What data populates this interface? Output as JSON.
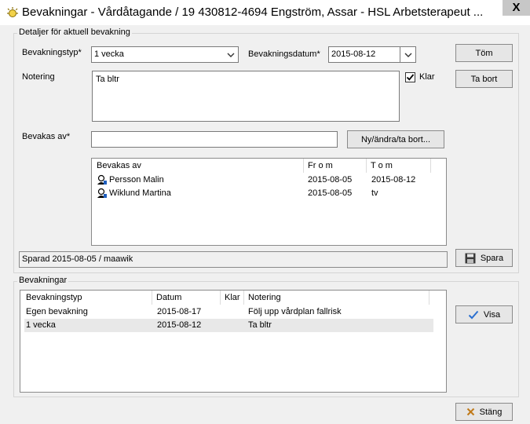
{
  "window": {
    "title": "Bevakningar - Vårdåtagande /  19 430812-4694   Engström, Assar   -   HSL Arbetsterapeut  ...",
    "close_label": "X"
  },
  "details": {
    "legend": "Detaljer för aktuell bevakning",
    "type_label": "Bevakningstyp*",
    "type_value": "1 vecka",
    "date_label": "Bevakningsdatum*",
    "date_value": "2015-08-12",
    "note_label": "Notering",
    "note_value": "Ta bltr",
    "done_label": "Klar",
    "done_checked": true,
    "watched_by_label": "Bevakas av*",
    "watched_by_value": "",
    "new_edit_remove_label": "Ny/ändra/ta bort...",
    "clear_label": "Töm",
    "remove_label": "Ta bort",
    "save_label": "Spara",
    "status_text": "Sparad 2015-08-05 / maawik",
    "watchers_table": {
      "columns": [
        "Bevakas av",
        "Fr o m",
        "T o m"
      ],
      "rows": [
        {
          "name": "Persson Malin",
          "from": "2015-08-05",
          "to": "2015-08-12"
        },
        {
          "name": "Wiklund Martina",
          "from": "2015-08-05",
          "to": "tv"
        }
      ]
    }
  },
  "watches": {
    "legend": "Bevakningar",
    "show_label": "Visa",
    "table": {
      "columns": [
        "Bevakningstyp",
        "Datum",
        "Klar",
        "Notering"
      ],
      "rows": [
        {
          "type": "Egen bevakning",
          "date": "2015-08-17",
          "done": "",
          "note": "Följ upp vårdplan fallrisk"
        },
        {
          "type": "1 vecka",
          "date": "2015-08-12",
          "done": "",
          "note": "Ta bltr"
        }
      ],
      "selected_row": 1
    }
  },
  "footer": {
    "close_label": "Stäng"
  }
}
